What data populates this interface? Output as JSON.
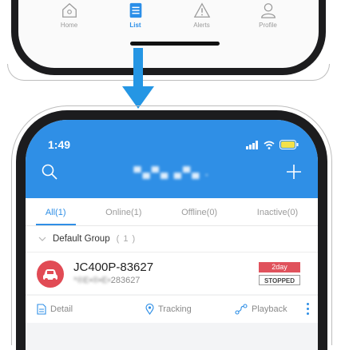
{
  "tab_bar": {
    "items": [
      {
        "label": "Home",
        "icon": "home-icon"
      },
      {
        "label": "List",
        "icon": "list-icon",
        "active": true
      },
      {
        "label": "Alerts",
        "icon": "alert-icon"
      },
      {
        "label": "Profile",
        "icon": "profile-icon"
      }
    ]
  },
  "status_bar": {
    "time": "1:49"
  },
  "header": {
    "title": "▀▄▀▄ ▄▀▄ .",
    "search_icon": "search-icon",
    "add_icon": "plus-icon"
  },
  "filters": [
    {
      "label": "All(1)",
      "active": true
    },
    {
      "label": "Online(1)"
    },
    {
      "label": "Offline(0)"
    },
    {
      "label": "Inactive(0)"
    }
  ],
  "group": {
    "name": "Default Group",
    "count": "( 1 )"
  },
  "device": {
    "name": "JC400P-83627",
    "imei_hidden": "*®E•®•E•",
    "imei_visible": "283627",
    "badge_duration": "2day",
    "status": "STOPPED"
  },
  "actions": [
    {
      "label": "Detail",
      "icon": "document-icon"
    },
    {
      "label": "Tracking",
      "icon": "location-pin-icon"
    },
    {
      "label": "Playback",
      "icon": "route-icon"
    }
  ],
  "colors": {
    "accent": "#2f8fe6",
    "danger": "#e14b55"
  }
}
